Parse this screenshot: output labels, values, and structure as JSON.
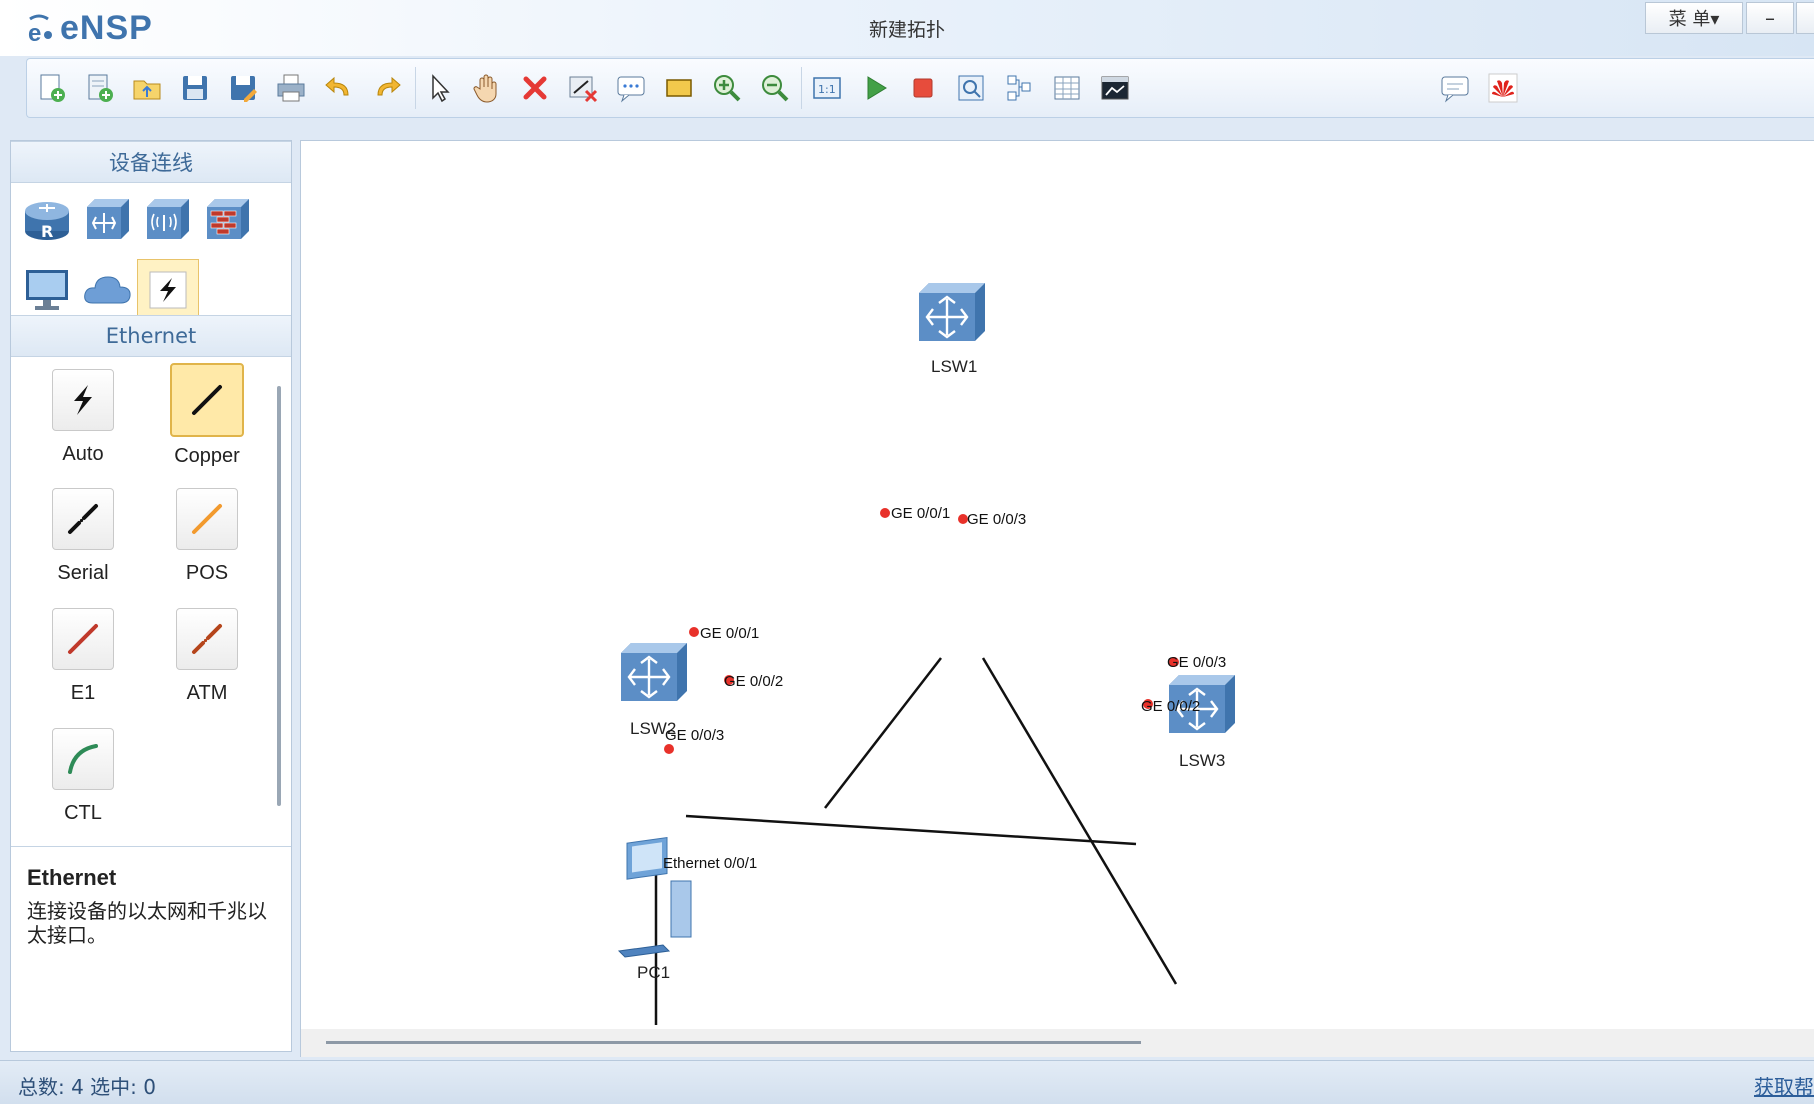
{
  "app": {
    "logo_text": "eNSP",
    "window_title": "新建拓扑",
    "menu_label": "菜 单▾",
    "minimize_label": "–"
  },
  "toolbar": {
    "buttons": [
      {
        "name": "new-topology-icon"
      },
      {
        "name": "new-example-icon"
      },
      {
        "name": "open-icon"
      },
      {
        "name": "save-icon"
      },
      {
        "name": "save-as-icon"
      },
      {
        "name": "print-icon"
      },
      {
        "name": "undo-icon"
      },
      {
        "name": "redo-icon"
      },
      {
        "name": "select-pointer-icon"
      },
      {
        "name": "pan-hand-icon"
      },
      {
        "name": "delete-icon"
      },
      {
        "name": "delete-all-links-icon"
      },
      {
        "name": "add-text-icon"
      },
      {
        "name": "palette-icon"
      },
      {
        "name": "zoom-in-icon"
      },
      {
        "name": "zoom-out-icon"
      },
      {
        "name": "fit-size-icon"
      },
      {
        "name": "start-devices-icon"
      },
      {
        "name": "stop-devices-icon"
      },
      {
        "name": "capture-data-icon"
      },
      {
        "name": "show-grid-icon"
      },
      {
        "name": "topology-table-icon"
      },
      {
        "name": "cli-icon"
      },
      {
        "name": "chat-forum-icon"
      },
      {
        "name": "huawei-logo-icon"
      }
    ]
  },
  "left_panel": {
    "device_header": "设备连线",
    "devices": [
      {
        "name": "router-device"
      },
      {
        "name": "switch-device"
      },
      {
        "name": "wlan-device"
      },
      {
        "name": "firewall-device"
      },
      {
        "name": "terminal-device"
      },
      {
        "name": "cloud-device"
      },
      {
        "name": "link-device"
      }
    ],
    "cable_header": "Ethernet",
    "cables": [
      {
        "label": "Auto",
        "color": "#111111"
      },
      {
        "label": "Copper",
        "color": "#111111"
      },
      {
        "label": "Serial",
        "color": "#111111"
      },
      {
        "label": "POS",
        "color": "#f29a2e"
      },
      {
        "label": "E1",
        "color": "#c0392b"
      },
      {
        "label": "ATM",
        "color": "#b5451b"
      },
      {
        "label": "CTL",
        "color": "#2e8b57"
      }
    ],
    "description": {
      "title": "Ethernet",
      "body": "连接设备的以太网和千兆以太接口。"
    }
  },
  "topology": {
    "devices": [
      {
        "id": "LSW1",
        "label": "LSW1",
        "type": "switch"
      },
      {
        "id": "LSW2",
        "label": "LSW2",
        "type": "switch"
      },
      {
        "id": "LSW3",
        "label": "LSW3",
        "type": "switch"
      },
      {
        "id": "PC1",
        "label": "PC1",
        "type": "pc"
      }
    ],
    "links": [
      {
        "from": "LSW1",
        "from_port": "GE 0/0/1",
        "to": "LSW2",
        "to_port": "GE 0/0/1"
      },
      {
        "from": "LSW1",
        "from_port": "GE 0/0/3",
        "to": "LSW3",
        "to_port": "GE 0/0/3"
      },
      {
        "from": "LSW2",
        "from_port": "GE 0/0/2",
        "to": "LSW3",
        "to_port": "GE 0/0/2"
      },
      {
        "from": "LSW2",
        "from_port": "GE 0/0/3",
        "to": "PC1",
        "to_port": "Ethernet 0/0/1"
      }
    ],
    "port_dot_color": "#e8312a"
  },
  "status": {
    "summary": "总数: 4  选中: 0",
    "help_link": "获取帮"
  }
}
